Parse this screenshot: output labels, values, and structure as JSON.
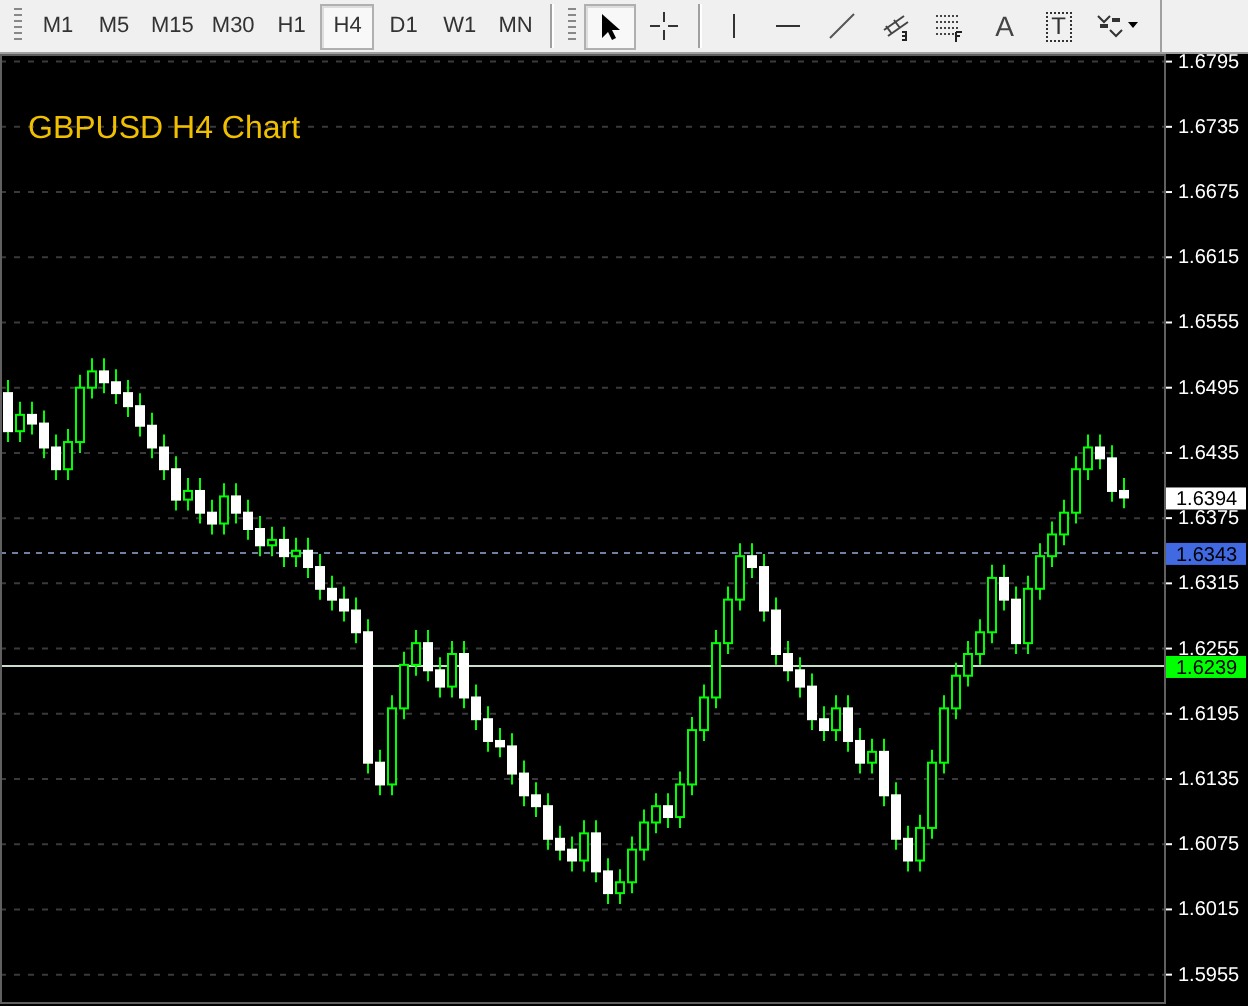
{
  "toolbar": {
    "timeframes": [
      {
        "label": "M1",
        "selected": false
      },
      {
        "label": "M5",
        "selected": false
      },
      {
        "label": "M15",
        "selected": false
      },
      {
        "label": "M30",
        "selected": false
      },
      {
        "label": "H1",
        "selected": false
      },
      {
        "label": "H4",
        "selected": true
      },
      {
        "label": "D1",
        "selected": false
      },
      {
        "label": "W1",
        "selected": false
      },
      {
        "label": "MN",
        "selected": false
      }
    ],
    "tools": [
      {
        "kind": "cursor",
        "selected": true
      },
      {
        "kind": "crosshair",
        "selected": false
      },
      {
        "kind": "vline",
        "selected": false
      },
      {
        "kind": "hline",
        "selected": false
      },
      {
        "kind": "trendline",
        "selected": false
      },
      {
        "kind": "channel",
        "selected": false
      },
      {
        "kind": "fibo",
        "selected": false
      },
      {
        "kind": "text",
        "label": "A",
        "selected": false
      },
      {
        "kind": "label",
        "label": "T",
        "selected": false
      },
      {
        "kind": "arrows",
        "selected": false
      }
    ]
  },
  "chart": {
    "title": "GBPUSD H4 Chart",
    "chart_data": {
      "type": "candlestick",
      "ylim": [
        1.5928,
        1.6802
      ],
      "grid": true,
      "ref_lines": [
        {
          "axis": "y",
          "value": 1.6343,
          "color": "#7080a0"
        },
        {
          "axis": "y",
          "value": 1.6239,
          "color": "#c8e0c8"
        }
      ],
      "yticks": [
        1.6795,
        1.6735,
        1.6675,
        1.6615,
        1.6555,
        1.6495,
        1.6435,
        1.6375,
        1.6315,
        1.6255,
        1.6195,
        1.6135,
        1.6075,
        1.6015,
        1.5955
      ],
      "ohlc": [
        [
          1.649,
          1.6502,
          1.6445,
          1.6455
        ],
        [
          1.6455,
          1.6482,
          1.6445,
          1.647
        ],
        [
          1.647,
          1.6482,
          1.6452,
          1.6462
        ],
        [
          1.6462,
          1.6474,
          1.643,
          1.644
        ],
        [
          1.644,
          1.6452,
          1.641,
          1.642
        ],
        [
          1.642,
          1.6457,
          1.641,
          1.6445
        ],
        [
          1.6445,
          1.6507,
          1.6435,
          1.6495
        ],
        [
          1.6495,
          1.6522,
          1.6485,
          1.651
        ],
        [
          1.651,
          1.6522,
          1.649,
          1.65
        ],
        [
          1.65,
          1.6512,
          1.648,
          1.649
        ],
        [
          1.649,
          1.6502,
          1.6468,
          1.6478
        ],
        [
          1.6478,
          1.649,
          1.645,
          1.646
        ],
        [
          1.646,
          1.6472,
          1.643,
          1.644
        ],
        [
          1.644,
          1.6452,
          1.641,
          1.642
        ],
        [
          1.642,
          1.6432,
          1.6382,
          1.6392
        ],
        [
          1.6392,
          1.6412,
          1.6382,
          1.64
        ],
        [
          1.64,
          1.6412,
          1.637,
          1.638
        ],
        [
          1.638,
          1.6392,
          1.636,
          1.637
        ],
        [
          1.637,
          1.6407,
          1.636,
          1.6395
        ],
        [
          1.6395,
          1.6407,
          1.637,
          1.638
        ],
        [
          1.638,
          1.6392,
          1.6355,
          1.6365
        ],
        [
          1.6365,
          1.6377,
          1.634,
          1.635
        ],
        [
          1.635,
          1.6367,
          1.634,
          1.6355
        ],
        [
          1.6355,
          1.6367,
          1.633,
          1.634
        ],
        [
          1.634,
          1.6357,
          1.633,
          1.6345
        ],
        [
          1.6345,
          1.6357,
          1.632,
          1.633
        ],
        [
          1.633,
          1.6342,
          1.63,
          1.631
        ],
        [
          1.631,
          1.6322,
          1.629,
          1.63
        ],
        [
          1.63,
          1.6312,
          1.628,
          1.629
        ],
        [
          1.629,
          1.6302,
          1.626,
          1.627
        ],
        [
          1.627,
          1.6282,
          1.614,
          1.615
        ],
        [
          1.615,
          1.6162,
          1.612,
          1.613
        ],
        [
          1.613,
          1.6212,
          1.612,
          1.62
        ],
        [
          1.62,
          1.6252,
          1.619,
          1.624
        ],
        [
          1.624,
          1.6272,
          1.623,
          1.626
        ],
        [
          1.626,
          1.6272,
          1.6225,
          1.6235
        ],
        [
          1.6235,
          1.6247,
          1.621,
          1.622
        ],
        [
          1.622,
          1.6262,
          1.621,
          1.625
        ],
        [
          1.625,
          1.6262,
          1.62,
          1.621
        ],
        [
          1.621,
          1.6222,
          1.618,
          1.619
        ],
        [
          1.619,
          1.6202,
          1.616,
          1.617
        ],
        [
          1.617,
          1.6182,
          1.6155,
          1.6165
        ],
        [
          1.6165,
          1.6177,
          1.613,
          1.614
        ],
        [
          1.614,
          1.6152,
          1.611,
          1.612
        ],
        [
          1.612,
          1.6132,
          1.61,
          1.611
        ],
        [
          1.611,
          1.6122,
          1.607,
          1.608
        ],
        [
          1.608,
          1.6092,
          1.606,
          1.607
        ],
        [
          1.607,
          1.6082,
          1.605,
          1.606
        ],
        [
          1.606,
          1.6097,
          1.605,
          1.6085
        ],
        [
          1.6085,
          1.6097,
          1.604,
          1.605
        ],
        [
          1.605,
          1.6062,
          1.602,
          1.603
        ],
        [
          1.603,
          1.6052,
          1.602,
          1.604
        ],
        [
          1.604,
          1.6082,
          1.603,
          1.607
        ],
        [
          1.607,
          1.6107,
          1.606,
          1.6095
        ],
        [
          1.6095,
          1.6122,
          1.6085,
          1.611
        ],
        [
          1.611,
          1.6122,
          1.609,
          1.61
        ],
        [
          1.61,
          1.6142,
          1.609,
          1.613
        ],
        [
          1.613,
          1.6192,
          1.612,
          1.618
        ],
        [
          1.618,
          1.6222,
          1.617,
          1.621
        ],
        [
          1.621,
          1.6272,
          1.62,
          1.626
        ],
        [
          1.626,
          1.6312,
          1.625,
          1.63
        ],
        [
          1.63,
          1.6352,
          1.629,
          1.634
        ],
        [
          1.634,
          1.6352,
          1.632,
          1.633
        ],
        [
          1.633,
          1.6342,
          1.628,
          1.629
        ],
        [
          1.629,
          1.6302,
          1.624,
          1.625
        ],
        [
          1.625,
          1.6262,
          1.6225,
          1.6235
        ],
        [
          1.6235,
          1.6247,
          1.621,
          1.622
        ],
        [
          1.622,
          1.6232,
          1.618,
          1.619
        ],
        [
          1.619,
          1.6202,
          1.617,
          1.618
        ],
        [
          1.618,
          1.6212,
          1.617,
          1.62
        ],
        [
          1.62,
          1.6212,
          1.616,
          1.617
        ],
        [
          1.617,
          1.6182,
          1.614,
          1.615
        ],
        [
          1.615,
          1.6172,
          1.614,
          1.616
        ],
        [
          1.616,
          1.6172,
          1.611,
          1.612
        ],
        [
          1.612,
          1.6132,
          1.607,
          1.608
        ],
        [
          1.608,
          1.6092,
          1.605,
          1.606
        ],
        [
          1.606,
          1.6102,
          1.605,
          1.609
        ],
        [
          1.609,
          1.6162,
          1.608,
          1.615
        ],
        [
          1.615,
          1.6212,
          1.614,
          1.62
        ],
        [
          1.62,
          1.6242,
          1.619,
          1.623
        ],
        [
          1.623,
          1.6262,
          1.622,
          1.625
        ],
        [
          1.625,
          1.6282,
          1.624,
          1.627
        ],
        [
          1.627,
          1.6332,
          1.626,
          1.632
        ],
        [
          1.632,
          1.6332,
          1.629,
          1.63
        ],
        [
          1.63,
          1.6312,
          1.625,
          1.626
        ],
        [
          1.626,
          1.6322,
          1.625,
          1.631
        ],
        [
          1.631,
          1.6352,
          1.63,
          1.634
        ],
        [
          1.634,
          1.6372,
          1.633,
          1.636
        ],
        [
          1.636,
          1.6392,
          1.635,
          1.638
        ],
        [
          1.638,
          1.6432,
          1.637,
          1.642
        ],
        [
          1.642,
          1.6452,
          1.641,
          1.644
        ],
        [
          1.644,
          1.6452,
          1.642,
          1.643
        ],
        [
          1.643,
          1.6442,
          1.639,
          1.64
        ],
        [
          1.64,
          1.6412,
          1.6384,
          1.6394
        ]
      ]
    },
    "price_markers": [
      {
        "label": "1.6394",
        "color": "#ffffff"
      },
      {
        "label": "1.6343",
        "color": "#4169e1"
      },
      {
        "label": "1.6239",
        "color": "#00ff00"
      }
    ]
  }
}
